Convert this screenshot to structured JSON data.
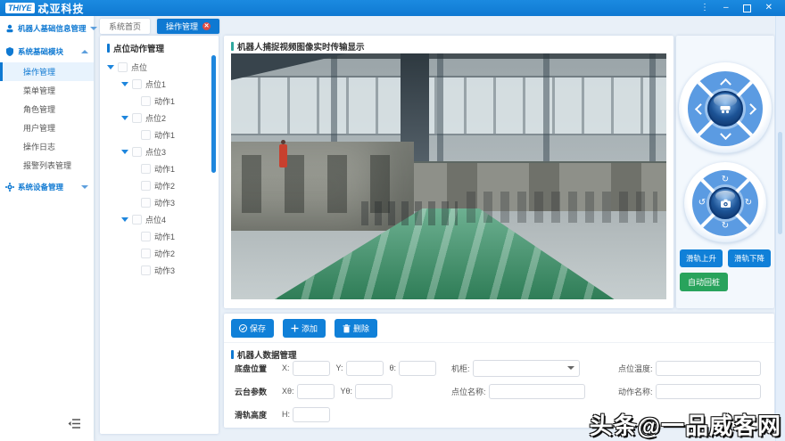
{
  "titlebar": {
    "logo_badge": "THIYE",
    "brand": "忒亚科技",
    "more_icon": "⋮",
    "minimize_icon": "–",
    "close_icon": "✕"
  },
  "tabs": {
    "home": "系统首页",
    "operation": "操作管理",
    "close_glyph": "✕"
  },
  "sidebar": {
    "groups": [
      {
        "label": "机器人基础信息管理"
      },
      {
        "label": "系统基础模块"
      },
      {
        "label": "系统设备管理"
      }
    ],
    "items": [
      {
        "label": "操作管理"
      },
      {
        "label": "菜单管理"
      },
      {
        "label": "角色管理"
      },
      {
        "label": "用户管理"
      },
      {
        "label": "操作日志"
      },
      {
        "label": "报警列表管理"
      }
    ],
    "active_item": "操作管理"
  },
  "tree": {
    "title": "点位动作管理",
    "nodes": [
      {
        "label": "点位"
      },
      {
        "label": "点位1"
      },
      {
        "label": "动作1"
      },
      {
        "label": "点位2"
      },
      {
        "label": "动作1"
      },
      {
        "label": "点位3"
      },
      {
        "label": "动作1"
      },
      {
        "label": "动作2"
      },
      {
        "label": "动作3"
      },
      {
        "label": "点位4"
      },
      {
        "label": "动作1"
      },
      {
        "label": "动作2"
      },
      {
        "label": "动作3"
      }
    ]
  },
  "video": {
    "title": "机器人捕捉视频图像实时传输显示"
  },
  "controls": {
    "rotate_cw": "↻",
    "rotate_ccw": "↺",
    "rail_up": "滑轨上升",
    "rail_down": "滑轨下降",
    "auto_return": "自动回桩"
  },
  "toolbar": {
    "save": "保存",
    "add": "添加",
    "delete": "删除"
  },
  "form": {
    "title": "机器人数据管理",
    "chassis_label": "底盘位置",
    "gimbal_label": "云台参数",
    "rail_label": "滑轨高度",
    "x_label": "X:",
    "y_label": "Y:",
    "theta_label": "θ:",
    "xtheta_label": "Xθ:",
    "ytheta_label": "Yθ:",
    "h_label": "H:",
    "cabinet_label": "机柜:",
    "point_name_label": "点位名称:",
    "point_temp_label": "点位温度:",
    "action_name_label": "动作名称:",
    "values": {
      "x": "",
      "y": "",
      "theta": "",
      "xtheta": "",
      "ytheta": "",
      "h": "",
      "cabinet": "",
      "point_name": "",
      "point_temp": "",
      "action_name": ""
    }
  },
  "watermark": "头条@一品威客网",
  "colors": {
    "accent": "#0f79d2",
    "green": "#28a35c",
    "tab_close_red": "#e04b43",
    "video_header_teal": "#2fa79e",
    "tree_scrollbar": "#1e86dd"
  }
}
